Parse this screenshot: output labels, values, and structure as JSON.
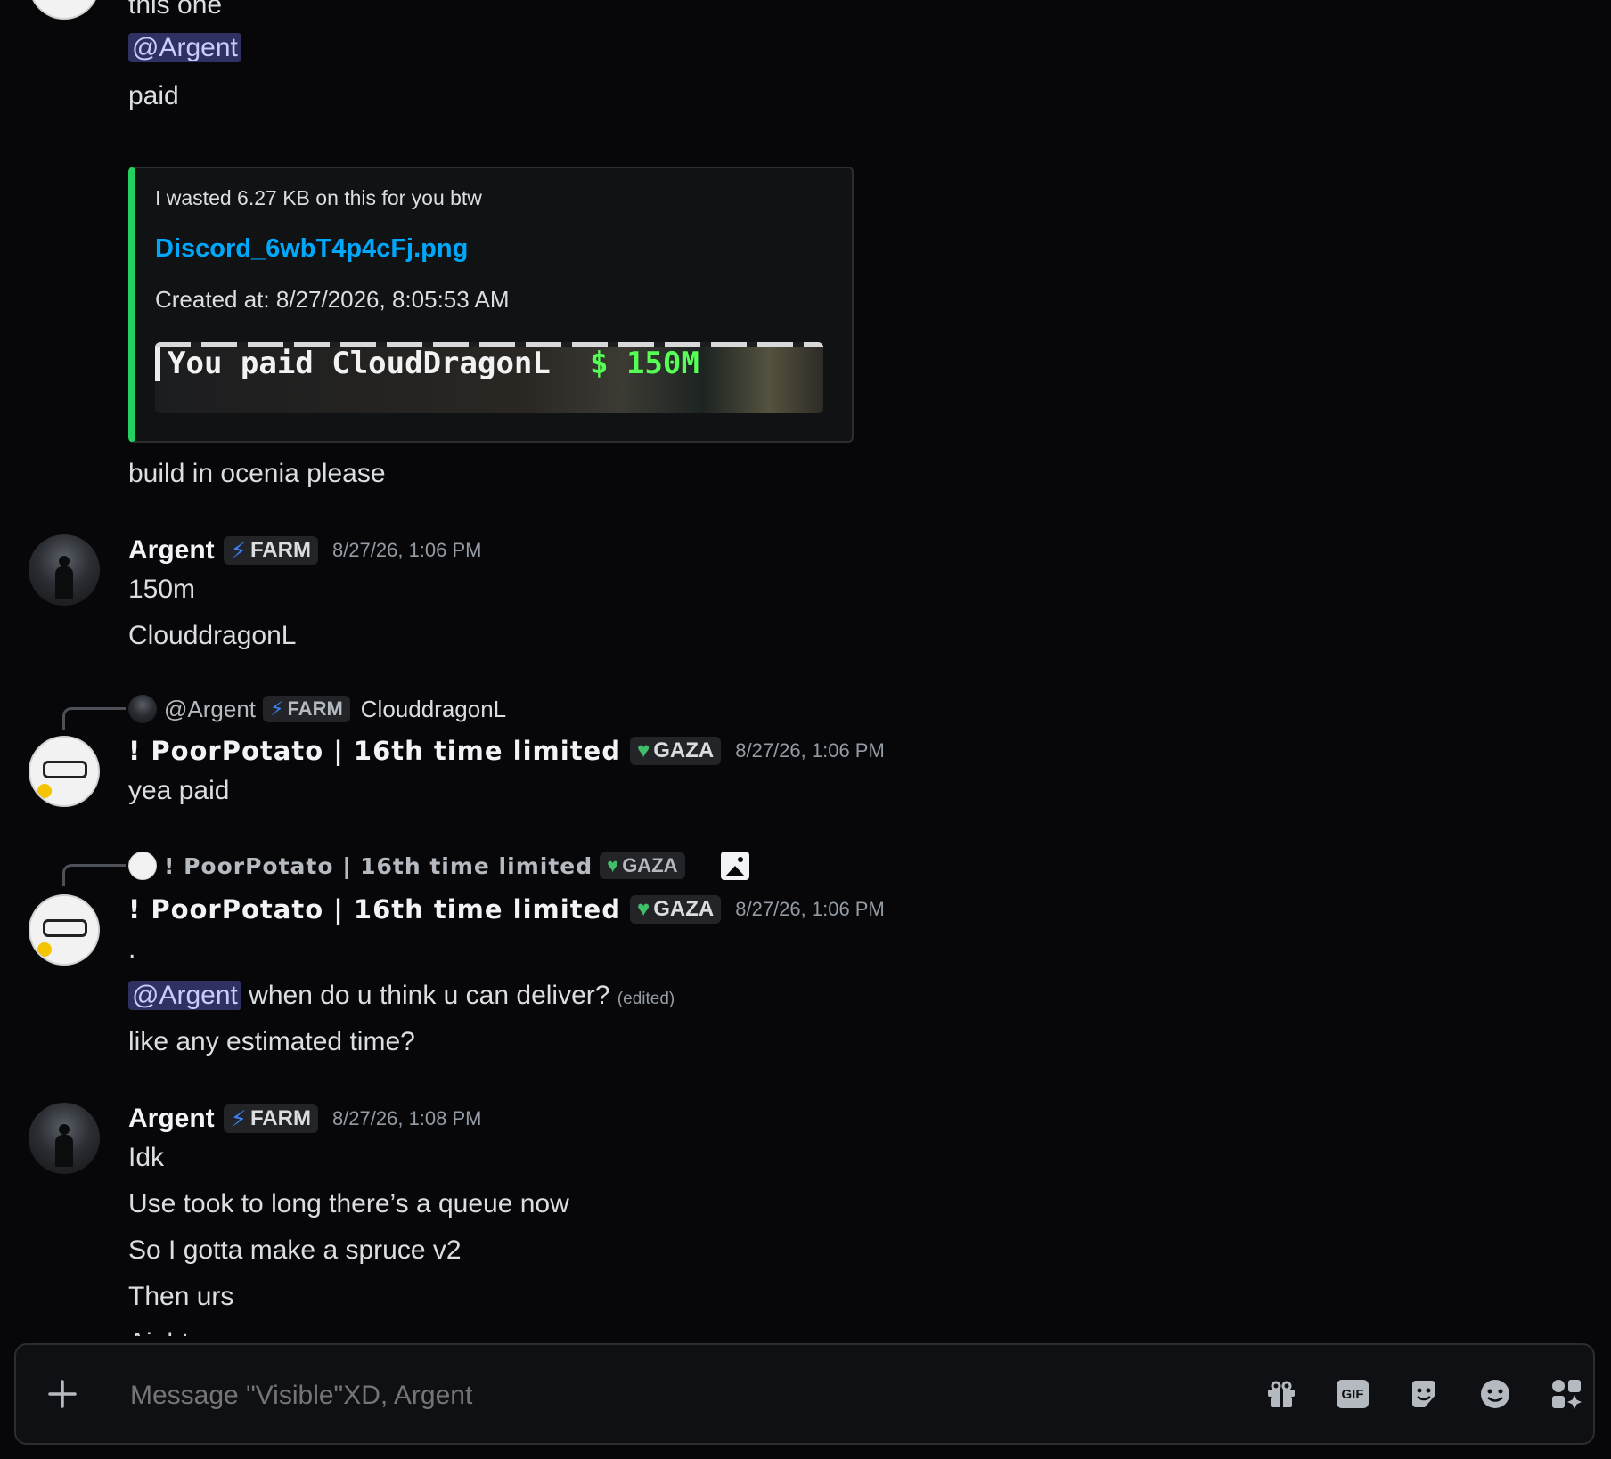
{
  "messages": {
    "m0": {
      "lines": [
        "this one"
      ],
      "mention": "@Argent",
      "line2": "paid"
    },
    "embed": {
      "author": "I wasted 6.27 KB on this for you btw",
      "title": "Discord_6wbT4p4cFj.png",
      "created": "Created at: 8/27/2026, 8:05:53 AM",
      "image_text": "You paid CloudDragonL",
      "image_amount": "$ 150M"
    },
    "m0_after": "build in ocenia please",
    "m1": {
      "username": "Argent",
      "tag": "FARM",
      "timestamp": "8/27/26, 1:06 PM",
      "lines": [
        "150m",
        "ClouddragonL"
      ]
    },
    "m2": {
      "reply": {
        "username": "@Argent",
        "tag": "FARM",
        "text": "ClouddragonL"
      },
      "username": "! PoorPotato | 16th time limited",
      "tag": "GAZA",
      "timestamp": "8/27/26, 1:06 PM",
      "lines": [
        "yea paid"
      ]
    },
    "m3": {
      "reply": {
        "username": "! PoorPotato | 16th time limited",
        "tag": "GAZA"
      },
      "username": "! PoorPotato | 16th time limited",
      "tag": "GAZA",
      "timestamp": "8/27/26, 1:06 PM",
      "dot": ".",
      "mention": "@Argent",
      "line_after_mention": " when do u think u can deliver?",
      "edited": "(edited)",
      "line3": "like any estimated time?"
    },
    "m4": {
      "username": "Argent",
      "tag": "FARM",
      "timestamp": "8/27/26, 1:08 PM",
      "lines": [
        "Idk",
        "Use took to long there’s a queue now",
        "So I gotta make a spruce v2",
        "Then urs",
        "Aight"
      ]
    }
  },
  "composer": {
    "placeholder": "Message \"Visible\"XD, Argent",
    "icons": [
      "plus-icon",
      "gift-icon",
      "gif-icon",
      "sticker-icon",
      "emoji-icon",
      "apps-icon"
    ],
    "gif_label": "GIF"
  },
  "colors": {
    "accent_green": "#23d160",
    "link_blue": "#00a8fc",
    "mention_bg": "#2e3161"
  }
}
